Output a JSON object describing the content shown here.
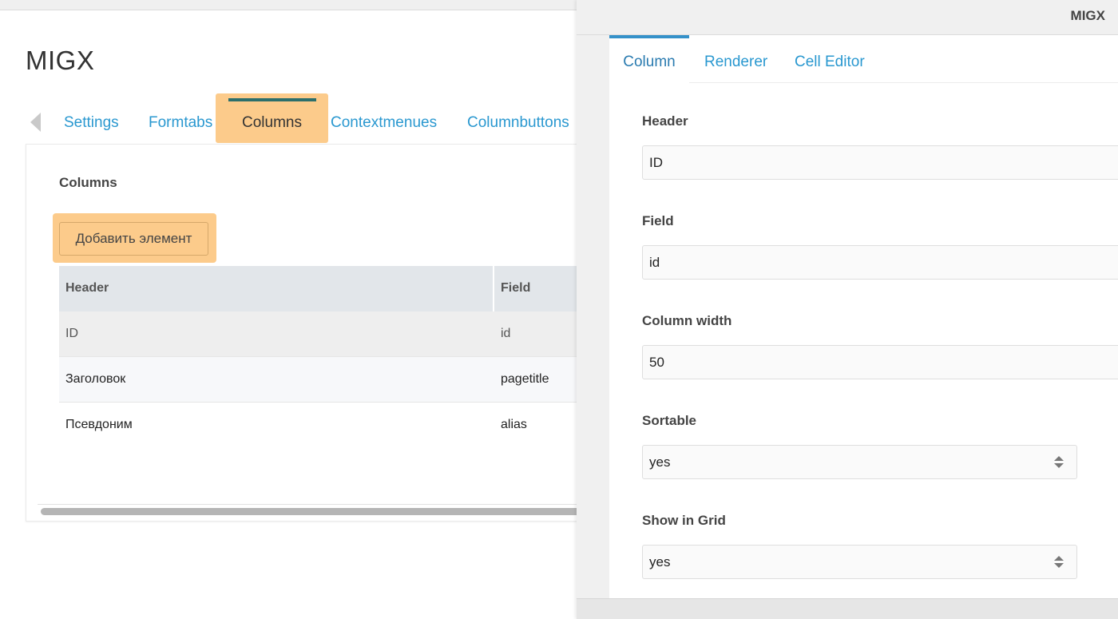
{
  "left": {
    "title": "MIGX",
    "tabs": [
      {
        "label": "Settings"
      },
      {
        "label": "Formtabs"
      },
      {
        "label": "Columns",
        "active": true
      },
      {
        "label": "Contextmenues"
      },
      {
        "label": "Columnbuttons"
      }
    ],
    "panel": {
      "heading": "Columns",
      "add_button": "Добавить элемент",
      "grid": {
        "columns": [
          "Header",
          "Field"
        ],
        "rows": [
          {
            "header": "ID",
            "field": "id"
          },
          {
            "header": "Заголовок",
            "field": "pagetitle"
          },
          {
            "header": "Псевдоним",
            "field": "alias"
          }
        ]
      }
    }
  },
  "window": {
    "title": "MIGX",
    "tabs": [
      {
        "label": "Column",
        "active": true
      },
      {
        "label": "Renderer"
      },
      {
        "label": "Cell Editor"
      }
    ],
    "form": {
      "header": {
        "label": "Header",
        "value": "ID"
      },
      "field": {
        "label": "Field",
        "value": "id"
      },
      "column_width": {
        "label": "Column width",
        "value": "50"
      },
      "sortable": {
        "label": "Sortable",
        "value": "yes"
      },
      "show_in_grid": {
        "label": "Show in Grid",
        "value": "yes"
      }
    }
  },
  "colors": {
    "link": "#2a98d0",
    "highlight": "#fccb8b",
    "active_tab_border": "#2c6f6b",
    "grid_header_bg": "#e2e6ea"
  }
}
